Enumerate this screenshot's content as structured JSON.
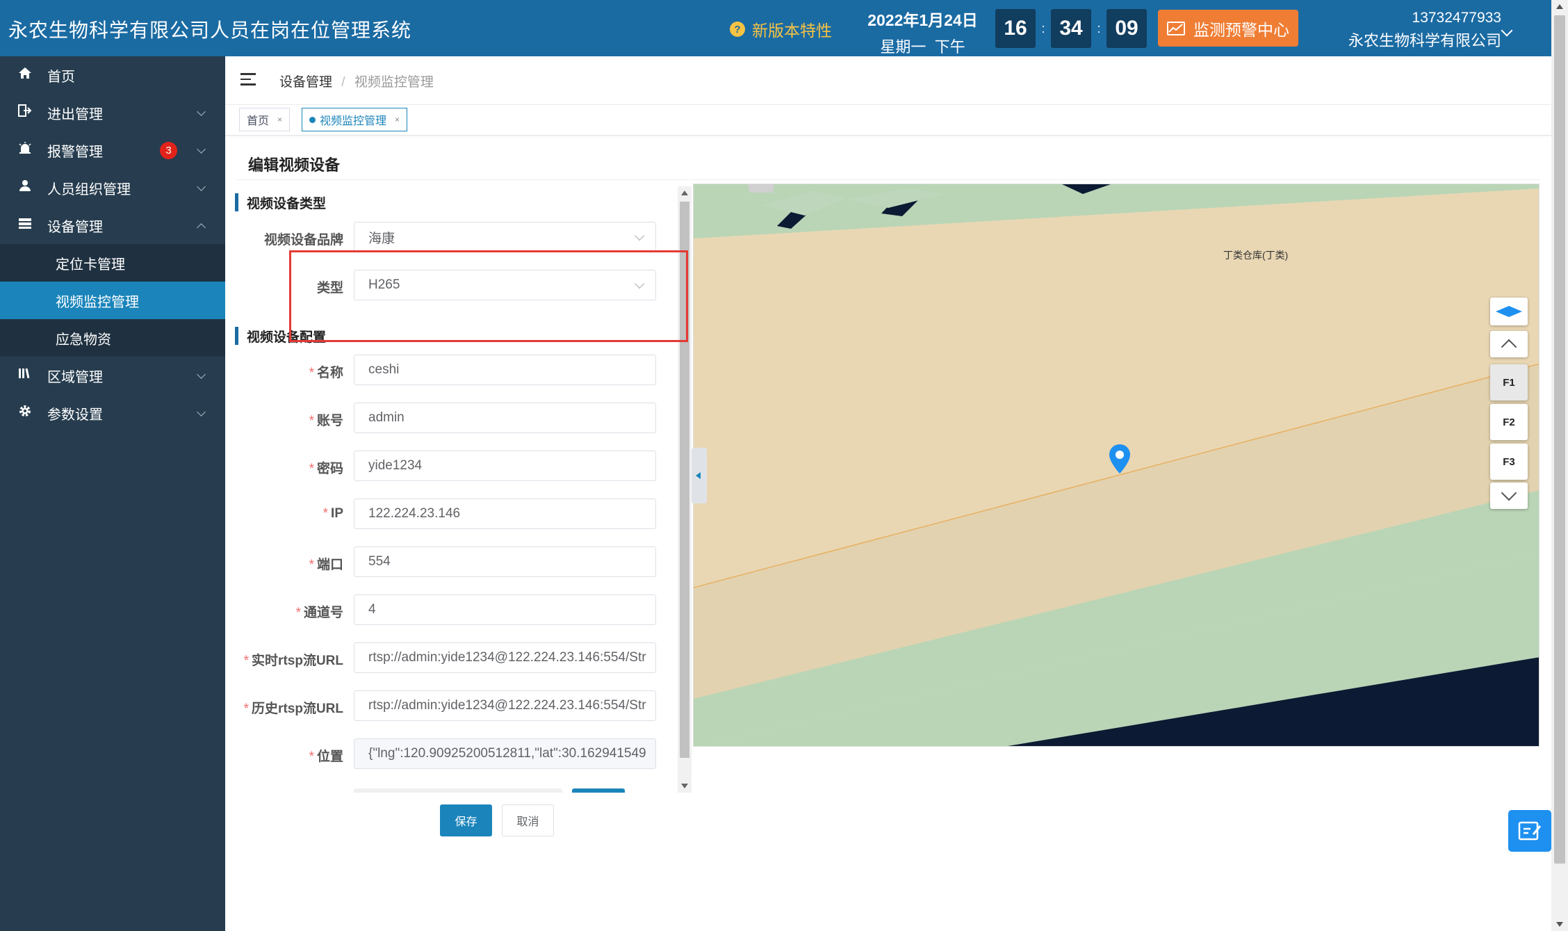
{
  "header": {
    "title": "永农生物科学有限公司人员在岗在位管理系统",
    "new_features": "新版本特性",
    "date": "2022年1月24日",
    "weekday": "星期一",
    "period": "下午",
    "clock": {
      "hour": "16",
      "minute": "34",
      "second": "09"
    },
    "alarm_center": "监测预警中心",
    "user_phone": "13732477933",
    "user_company": "永农生物科学有限公司"
  },
  "sidebar": {
    "items": [
      {
        "label": "首页",
        "icon": "home-icon"
      },
      {
        "label": "进出管理",
        "icon": "exit-icon"
      },
      {
        "label": "报警管理",
        "icon": "alarm-icon",
        "badge": "3"
      },
      {
        "label": "人员组织管理",
        "icon": "user-icon"
      },
      {
        "label": "设备管理",
        "icon": "device-icon",
        "expanded": true
      },
      {
        "label": "区域管理",
        "icon": "area-icon"
      },
      {
        "label": "参数设置",
        "icon": "gear-icon"
      }
    ],
    "sub_items": [
      {
        "label": "定位卡管理"
      },
      {
        "label": "视频监控管理",
        "active": true
      },
      {
        "label": "应急物资"
      }
    ]
  },
  "breadcrumb": {
    "parent": "设备管理",
    "separator": "/",
    "current": "视频监控管理"
  },
  "tabs": [
    {
      "label": "首页"
    },
    {
      "label": "视频监控管理",
      "active": true
    }
  ],
  "panel": {
    "title": "编辑视频设备"
  },
  "form": {
    "section_type": "视频设备类型",
    "section_config": "视频设备配置",
    "brand_label": "视频设备品牌",
    "brand_value": "海康",
    "type_label": "类型",
    "type_value": "H265",
    "name_label": "名称",
    "name_value": "ceshi",
    "account_label": "账号",
    "account_value": "admin",
    "password_label": "密码",
    "password_value": "yide1234",
    "ip_label": "IP",
    "ip_value": "122.224.23.146",
    "port_label": "端口",
    "port_value": "554",
    "channel_label": "通道号",
    "channel_value": "4",
    "live_url_label": "实时rtsp流URL",
    "live_url_value": "rtsp://admin:yide1234@122.224.23.146:554/Str",
    "history_url_label": "历史rtsp流URL",
    "history_url_value": "rtsp://admin:yide1234@122.224.23.146:554/Str",
    "position_label": "位置",
    "position_value": "{\"lng\":120.90925200512811,\"lat\":30.162941549",
    "required_mark": "*"
  },
  "buttons": {
    "save": "保存",
    "cancel": "取消"
  },
  "map": {
    "area_label": "丁类仓库(丁类)",
    "floors": [
      "F1",
      "F2",
      "F3"
    ],
    "active_floor": "F1"
  },
  "colors": {
    "header": "#1b6ba3",
    "sidebar": "#273d4f",
    "active": "#1b85bb",
    "alarm": "#ef7d34",
    "highlight": "#e53935"
  }
}
